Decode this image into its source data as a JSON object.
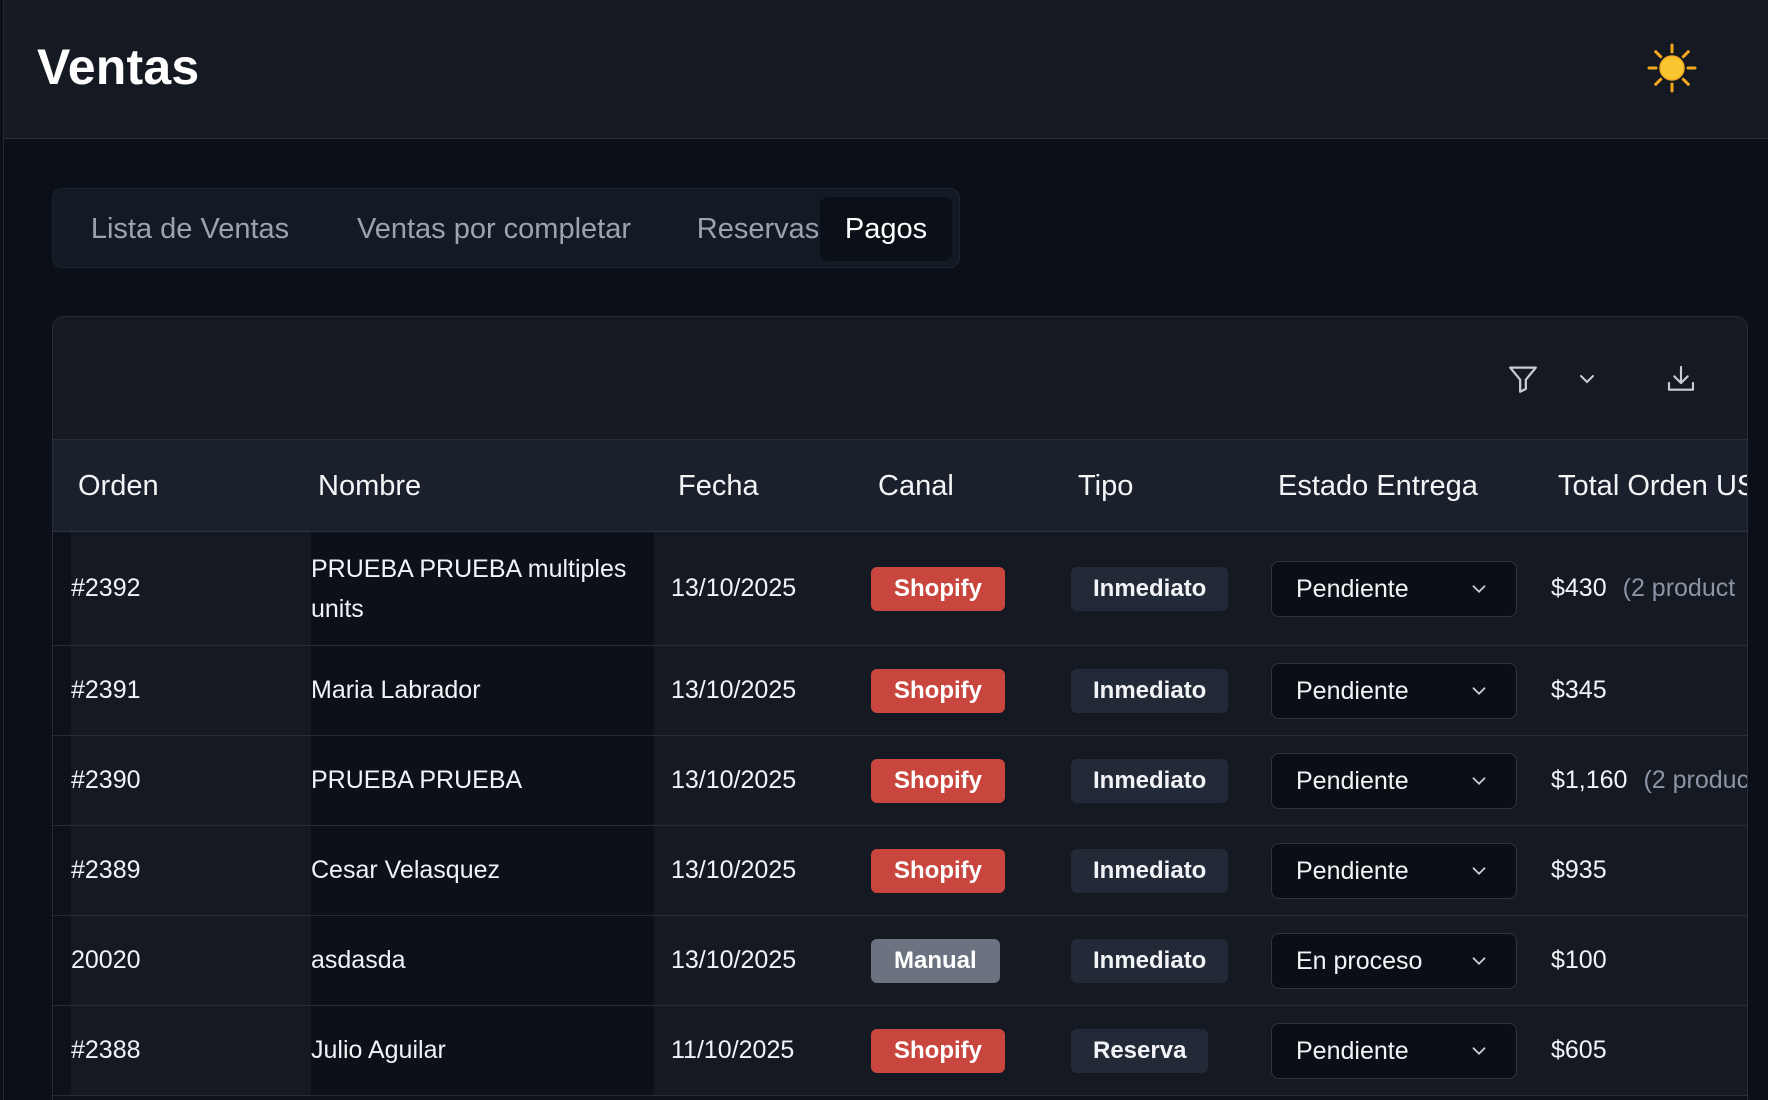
{
  "header": {
    "title": "Ventas",
    "theme_icon": "sun-icon"
  },
  "tabs": [
    {
      "label": "Lista de Ventas",
      "active": false
    },
    {
      "label": "Ventas por completar",
      "active": false
    },
    {
      "label": "Reservas",
      "active": false
    },
    {
      "label": "Pagos",
      "active": true
    }
  ],
  "toolbar": {
    "icons": [
      "filter-icon",
      "chevron-down-icon",
      "download-icon"
    ]
  },
  "table": {
    "columns": [
      "Orden",
      "Nombre",
      "Fecha",
      "Canal",
      "Tipo",
      "Estado Entrega",
      "Total Orden US"
    ],
    "rows": [
      {
        "orden": "#2392",
        "nombre": "PRUEBA PRUEBA multiples units",
        "fecha": "13/10/2025",
        "canal": "Shopify",
        "tipo": "Inmediato",
        "estado": "Pendiente",
        "total": "$430",
        "extra": "(2 product"
      },
      {
        "orden": "#2391",
        "nombre": "Maria Labrador",
        "fecha": "13/10/2025",
        "canal": "Shopify",
        "tipo": "Inmediato",
        "estado": "Pendiente",
        "total": "$345",
        "extra": ""
      },
      {
        "orden": "#2390",
        "nombre": "PRUEBA PRUEBA",
        "fecha": "13/10/2025",
        "canal": "Shopify",
        "tipo": "Inmediato",
        "estado": "Pendiente",
        "total": "$1,160",
        "extra": "(2 produc"
      },
      {
        "orden": "#2389",
        "nombre": "Cesar Velasquez",
        "fecha": "13/10/2025",
        "canal": "Shopify",
        "tipo": "Inmediato",
        "estado": "Pendiente",
        "total": "$935",
        "extra": ""
      },
      {
        "orden": "20020",
        "nombre": "asdasda",
        "fecha": "13/10/2025",
        "canal": "Manual",
        "tipo": "Inmediato",
        "estado": "En proceso",
        "total": "$100",
        "extra": ""
      },
      {
        "orden": "#2388",
        "nombre": "Julio Aguilar",
        "fecha": "11/10/2025",
        "canal": "Shopify",
        "tipo": "Reserva",
        "estado": "Pendiente",
        "total": "$605",
        "extra": ""
      }
    ]
  },
  "colors": {
    "shopify": "#c9463f",
    "manual": "#6b7280",
    "background": "#0b0f17",
    "surface": "#141922"
  }
}
